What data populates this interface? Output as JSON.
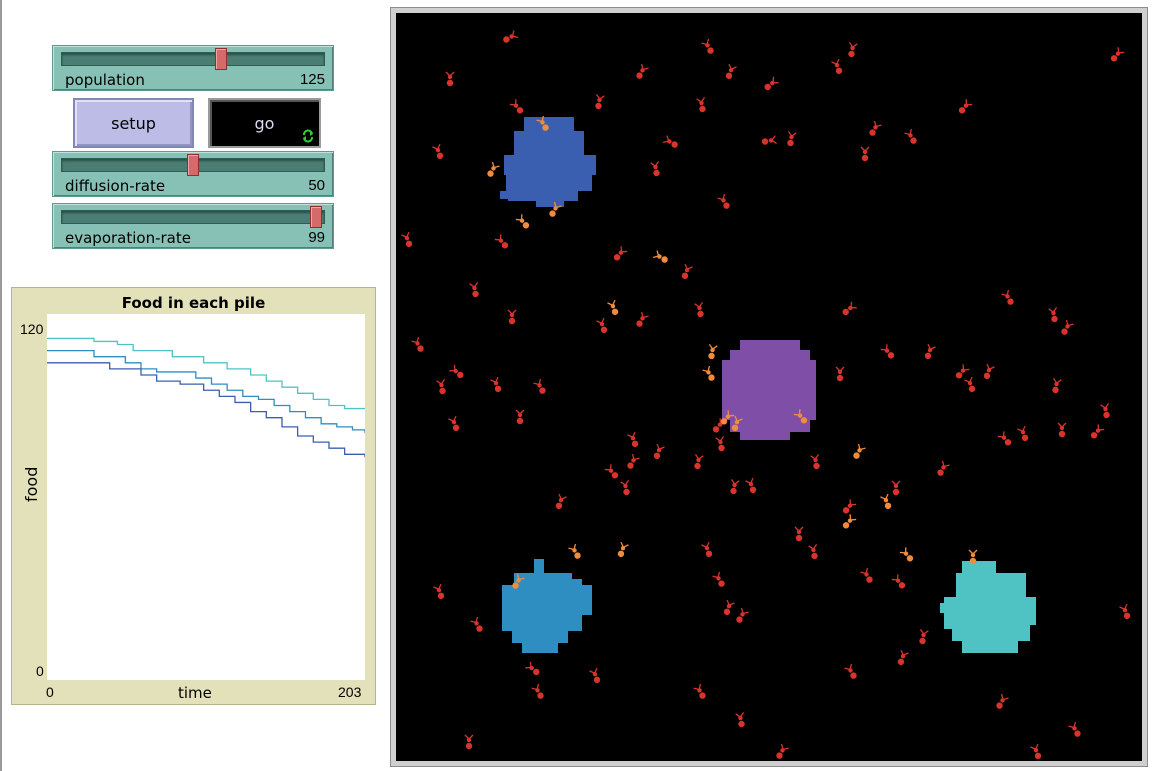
{
  "sliders": [
    {
      "label": "population",
      "value": "125",
      "fraction": 0.61
    },
    {
      "label": "diffusion-rate",
      "value": "50",
      "fraction": 0.5
    },
    {
      "label": "evaporation-rate",
      "value": "99",
      "fraction": 0.99
    }
  ],
  "buttons": {
    "setup": "setup",
    "go": "go"
  },
  "icons": {
    "forever": "forever-loop-icon"
  },
  "colors": {
    "slider": "#87c1b6",
    "setup_button": "#bcbce6",
    "plot_bg": "#e3e1b9",
    "ant": "#d8342c",
    "ant_carrying": "#f28c3c",
    "pile1": "#4fc3c4",
    "pile2": "#2e8ec2",
    "pile3": "#3a5fb0",
    "nest": "#7f4ea6"
  },
  "chart_data": {
    "type": "line",
    "title": "Food in each pile",
    "xlabel": "time",
    "ylabel": "food",
    "xlim": [
      0,
      203
    ],
    "ylim": [
      0,
      120
    ],
    "x_tick_labels": [
      "0",
      "203"
    ],
    "y_tick_labels": [
      "0",
      "120"
    ],
    "series": [
      {
        "color": "#4fc3c4",
        "points": [
          [
            0,
            112
          ],
          [
            20,
            112
          ],
          [
            30,
            111
          ],
          [
            45,
            110
          ],
          [
            55,
            108
          ],
          [
            70,
            108
          ],
          [
            80,
            106
          ],
          [
            95,
            106
          ],
          [
            100,
            104
          ],
          [
            110,
            104
          ],
          [
            115,
            102
          ],
          [
            125,
            102
          ],
          [
            130,
            100
          ],
          [
            140,
            98
          ],
          [
            150,
            96
          ],
          [
            160,
            94
          ],
          [
            170,
            92
          ],
          [
            180,
            90
          ],
          [
            190,
            89
          ],
          [
            203,
            89
          ]
        ]
      },
      {
        "color": "#2e8ec2",
        "points": [
          [
            0,
            108
          ],
          [
            20,
            108
          ],
          [
            30,
            106
          ],
          [
            50,
            104
          ],
          [
            60,
            102
          ],
          [
            70,
            101
          ],
          [
            85,
            101
          ],
          [
            95,
            99
          ],
          [
            105,
            97
          ],
          [
            115,
            95
          ],
          [
            125,
            93
          ],
          [
            135,
            92
          ],
          [
            145,
            90
          ],
          [
            155,
            88
          ],
          [
            165,
            86
          ],
          [
            175,
            84
          ],
          [
            185,
            83
          ],
          [
            195,
            82
          ],
          [
            203,
            81
          ]
        ]
      },
      {
        "color": "#3a5fb0",
        "points": [
          [
            0,
            104
          ],
          [
            25,
            104
          ],
          [
            40,
            102
          ],
          [
            60,
            100
          ],
          [
            70,
            98
          ],
          [
            85,
            97
          ],
          [
            100,
            95
          ],
          [
            110,
            93
          ],
          [
            120,
            91
          ],
          [
            130,
            88
          ],
          [
            140,
            86
          ],
          [
            150,
            83
          ],
          [
            160,
            80
          ],
          [
            170,
            78
          ],
          [
            180,
            76
          ],
          [
            190,
            74
          ],
          [
            203,
            73
          ]
        ]
      }
    ]
  }
}
